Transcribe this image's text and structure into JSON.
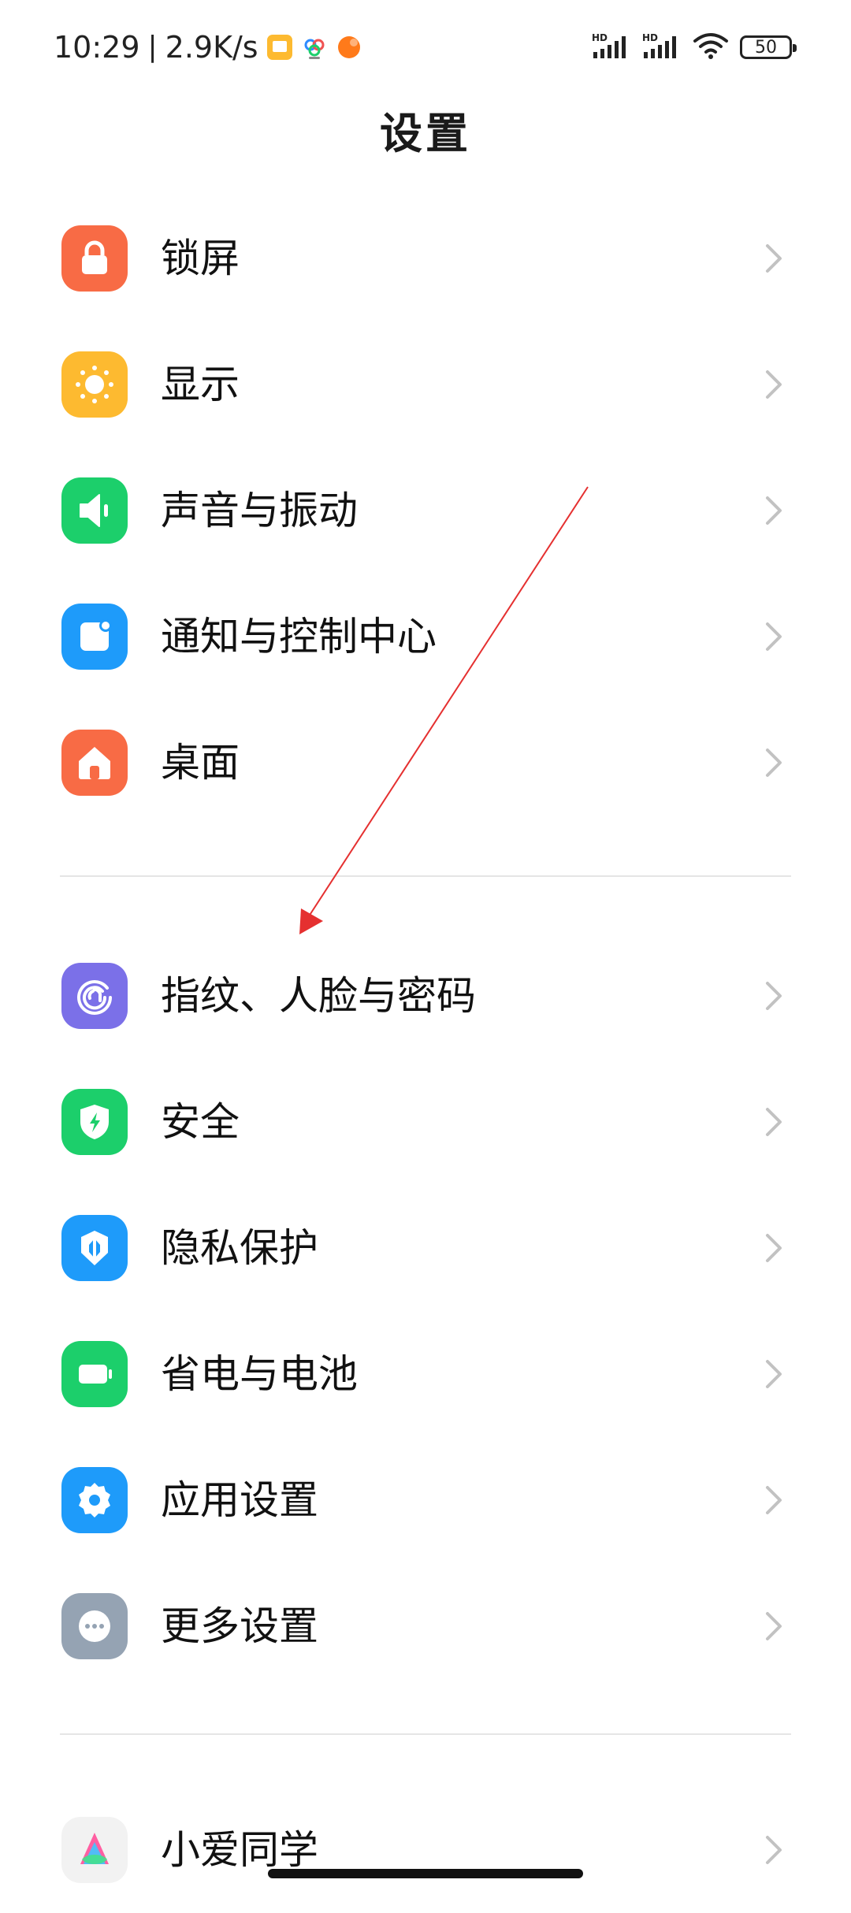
{
  "status_bar": {
    "time": "10:29",
    "separator": "|",
    "speed": "2.9K/s",
    "battery": "50",
    "signal1_label": "HD",
    "signal2_label": "HD"
  },
  "header": {
    "title": "设置"
  },
  "sections": [
    {
      "items": [
        {
          "label": "锁屏",
          "icon": "lock-icon",
          "color": "#F86B45"
        },
        {
          "label": "显示",
          "icon": "sun-icon",
          "color": "#FDBA30"
        },
        {
          "label": "声音与振动",
          "icon": "speaker-icon",
          "color": "#1CCF6B"
        },
        {
          "label": "通知与控制中心",
          "icon": "notification-icon",
          "color": "#1E9BFA"
        },
        {
          "label": "桌面",
          "icon": "home-icon",
          "color": "#F86B45"
        }
      ]
    },
    {
      "items": [
        {
          "label": "指纹、人脸与密码",
          "icon": "fingerprint-icon",
          "color": "#7B70E8"
        },
        {
          "label": "安全",
          "icon": "shield-icon",
          "color": "#1CCF6B"
        },
        {
          "label": "隐私保护",
          "icon": "privacy-icon",
          "color": "#1E9BFA"
        },
        {
          "label": "省电与电池",
          "icon": "battery-icon",
          "color": "#1CCF6B"
        },
        {
          "label": "应用设置",
          "icon": "gear-icon",
          "color": "#1E9BFA"
        },
        {
          "label": "更多设置",
          "icon": "more-icon",
          "color": "#95A3B3"
        }
      ]
    },
    {
      "items": [
        {
          "label": "小爱同学",
          "icon": "xiaoai-icon",
          "color": "#F2F2F2"
        }
      ]
    }
  ],
  "annotation": {
    "type": "arrow",
    "color": "#E53030",
    "points_to": "指纹、人脸与密码"
  }
}
